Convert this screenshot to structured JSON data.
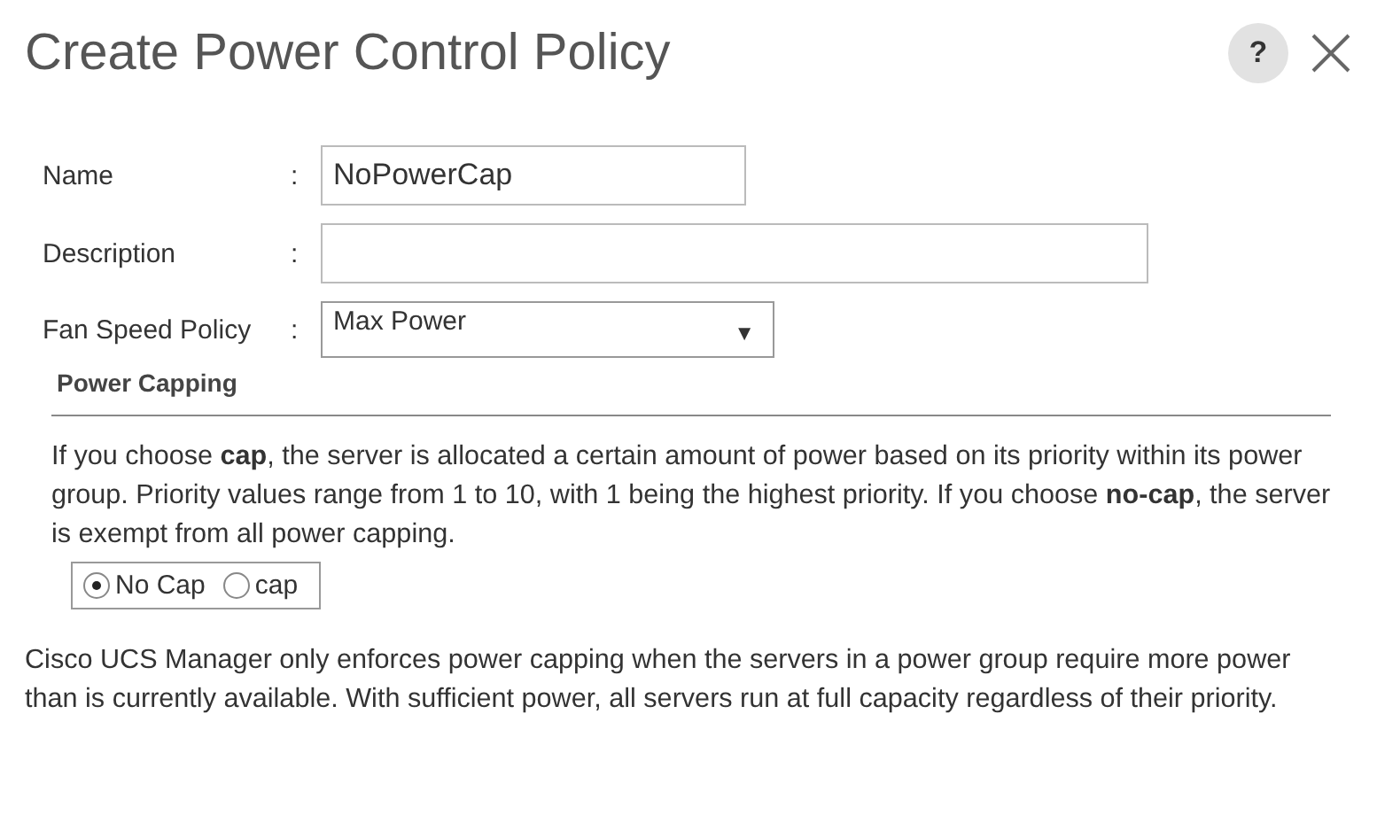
{
  "window": {
    "title": "Create Power Control Policy",
    "help": "?"
  },
  "fields": [
    {
      "kind": "text",
      "label": "Name",
      "value": "NoPowerCap"
    },
    {
      "kind": "text",
      "label": "Description"
    },
    {
      "kind": "select",
      "label": "Fan Speed Policy",
      "value": "Max Power",
      "caret": "▼"
    }
  ],
  "colon": ":",
  "section": {
    "title": "Power Capping",
    "description": "If you choose **cap**, the server is allocated a certain amount of power based on its priority within its power group. Priority values range from 1 to 10, with 1 being the highest priority. If you choose **no-cap**, the server is exempt from all power capping.",
    "options": [
      {
        "label": "No Cap",
        "selected": true
      },
      {
        "label": "cap",
        "selected": false
      }
    ]
  },
  "note": "Cisco UCS Manager only enforces power capping when the servers in a power group require more power than is currently available. With sufficient power, all servers run at full capacity regardless of their priority."
}
